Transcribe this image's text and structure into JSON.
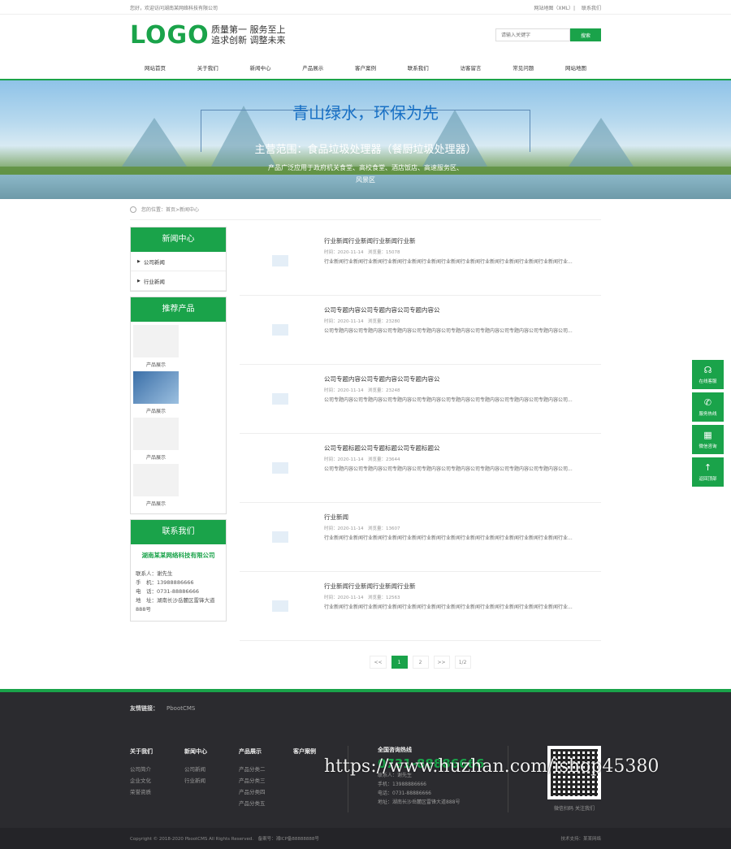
{
  "topbar": {
    "greeting": "您好，欢迎访问湖南某网络科技有限公司",
    "sitemap": "网站地图（XML）",
    "contact": "联系我们"
  },
  "header": {
    "logo": "LOGO",
    "slogan1": "质量第一 服务至上",
    "slogan2": "追求创新 调整未来",
    "search_placeholder": "请输入关键字",
    "search_button": "搜索"
  },
  "nav": [
    "网站首页",
    "关于我们",
    "新闻中心",
    "产品展示",
    "客户案例",
    "联系我们",
    "访客留言",
    "常见问题",
    "网站地图"
  ],
  "banner": {
    "title": "青山绿水，环保为先",
    "subtitle": "主营范围：食品垃圾处理器（餐厨垃圾处理器）",
    "desc": "产品广泛应用于政府机关食堂、高校食堂、酒店饭店、高速服务区、风景区"
  },
  "breadcrumb": "您的位置：首页>新闻中心",
  "side": {
    "news_title": "新闻中心",
    "news_items": [
      "公司新闻",
      "行业新闻"
    ],
    "prod_title": "推荐产品",
    "prods": [
      "产品展示",
      "产品展示",
      "产品展示",
      "产品展示"
    ],
    "contact_title": "联系我们",
    "company": "湖南某某网络科技有限公司",
    "contact_lines": [
      "联系人：谢先生",
      "手　机：13988886666",
      "电　话：0731-88886666",
      "地　址：湖南长沙岳麓区雷锋大道888号"
    ]
  },
  "list": [
    {
      "title": "行业新闻行业新闻行业新闻行业新",
      "meta": "时间：2020-11-14　浏览量：15078",
      "desc": "行业新闻行业新闻行业新闻行业新闻行业新闻行业新闻行业新闻行业新闻行业新闻行业新闻行业新闻行业新闻行业..."
    },
    {
      "title": "公司专题内容公司专题内容公司专题内容公",
      "meta": "时间：2020-11-14　浏览量：23280",
      "desc": "公司专题内容公司专题内容公司专题内容公司专题内容公司专题内容公司专题内容公司专题内容公司专题内容公司..."
    },
    {
      "title": "公司专题内容公司专题内容公司专题内容公",
      "meta": "时间：2020-11-14　浏览量：23248",
      "desc": "公司专题内容公司专题内容公司专题内容公司专题内容公司专题内容公司专题内容公司专题内容公司专题内容公司..."
    },
    {
      "title": "公司专题标题公司专题标题公司专题标题公",
      "meta": "时间：2020-11-14　浏览量：23644",
      "desc": "公司专题内容公司专题内容公司专题内容公司专题内容公司专题内容公司专题内容公司专题内容公司专题内容公司..."
    },
    {
      "title": "行业新闻",
      "meta": "时间：2020-11-14　浏览量：13607",
      "desc": "行业新闻行业新闻行业新闻行业新闻行业新闻行业新闻行业新闻行业新闻行业新闻行业新闻行业新闻行业新闻行业..."
    },
    {
      "title": "行业新闻行业新闻行业新闻行业新",
      "meta": "时间：2020-11-14　浏览量：12563",
      "desc": "行业新闻行业新闻行业新闻行业新闻行业新闻行业新闻行业新闻行业新闻行业新闻行业新闻行业新闻行业新闻行业..."
    }
  ],
  "pager": {
    "prev": "<<",
    "p1": "1",
    "p2": "2",
    "next": ">>",
    "total": "1/2"
  },
  "float": [
    "在线客服",
    "服务热线",
    "微信咨询",
    "返回顶部"
  ],
  "footer": {
    "links_label": "友情链接：",
    "links": "PbootCMS",
    "cols": [
      {
        "title": "关于我们",
        "items": [
          "公司简介",
          "企业文化",
          "荣誉资质"
        ]
      },
      {
        "title": "新闻中心",
        "items": [
          "公司新闻",
          "行业新闻"
        ]
      },
      {
        "title": "产品展示",
        "items": [
          "产品分类二",
          "产品分类三",
          "产品分类四",
          "产品分类五"
        ]
      },
      {
        "title": "客户案例",
        "items": []
      }
    ],
    "hotline_title": "全国咨询热线",
    "hotline": "0731-88886666",
    "hotline_lines": [
      "联系人：谢先生",
      "手机：13988886666",
      "电话：0731-88886666",
      "地址：湖南长沙岳麓区雷锋大道888号"
    ],
    "qr_caption": "微信扫码 关注我们",
    "copyright": "Copyright © 2018-2020 PbootCMS All Rights Reserved.　备案号：湘ICP备88888888号",
    "support": "技术支持：某某网络"
  },
  "watermark": "https://www.huzhan.com/ishop45380",
  "colors": {
    "accent": "#1aa34a",
    "footer_bg": "#2b2b2f"
  }
}
